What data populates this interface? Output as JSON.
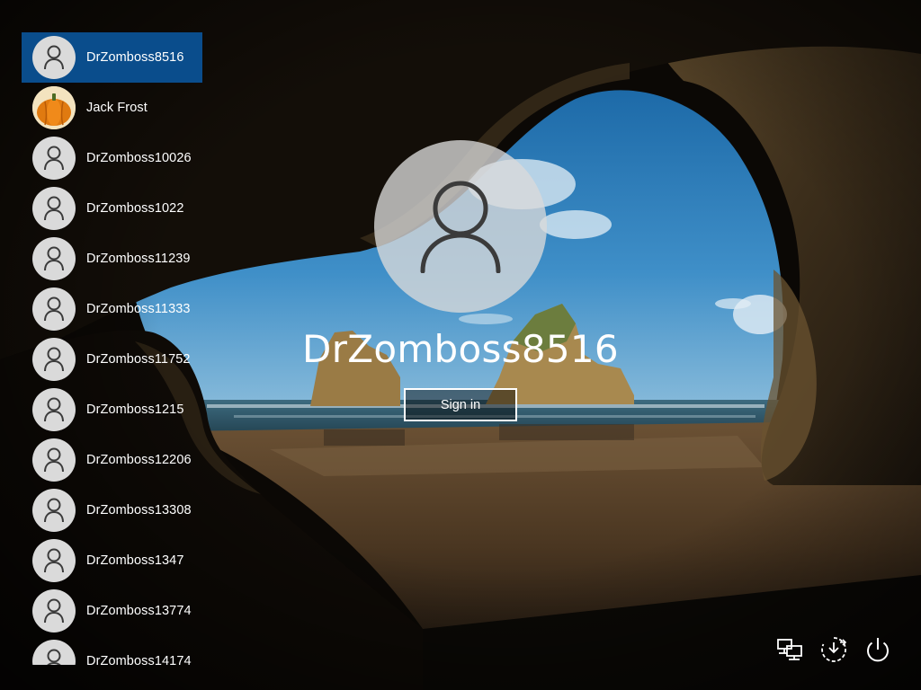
{
  "users": [
    {
      "name": "DrZomboss8516",
      "selected": true,
      "icon": "person-icon"
    },
    {
      "name": "Jack Frost",
      "selected": false,
      "icon": "pumpkin-avatar"
    },
    {
      "name": "DrZomboss10026",
      "selected": false,
      "icon": "person-icon"
    },
    {
      "name": "DrZomboss1022",
      "selected": false,
      "icon": "person-icon"
    },
    {
      "name": "DrZomboss11239",
      "selected": false,
      "icon": "person-icon"
    },
    {
      "name": "DrZomboss11333",
      "selected": false,
      "icon": "person-icon"
    },
    {
      "name": "DrZomboss11752",
      "selected": false,
      "icon": "person-icon"
    },
    {
      "name": "DrZomboss1215",
      "selected": false,
      "icon": "person-icon"
    },
    {
      "name": "DrZomboss12206",
      "selected": false,
      "icon": "person-icon"
    },
    {
      "name": "DrZomboss13308",
      "selected": false,
      "icon": "person-icon"
    },
    {
      "name": "DrZomboss1347",
      "selected": false,
      "icon": "person-icon"
    },
    {
      "name": "DrZomboss13774",
      "selected": false,
      "icon": "person-icon"
    },
    {
      "name": "DrZomboss14174",
      "selected": false,
      "icon": "person-icon"
    }
  ],
  "signin": {
    "username": "DrZomboss8516",
    "button_label": "Sign in"
  },
  "system_icons": [
    "network-icon",
    "accessibility-icon",
    "power-icon"
  ],
  "colors": {
    "selected_background": "#0a4d8c",
    "avatar_background": "#dadada",
    "text": "#ffffff"
  }
}
